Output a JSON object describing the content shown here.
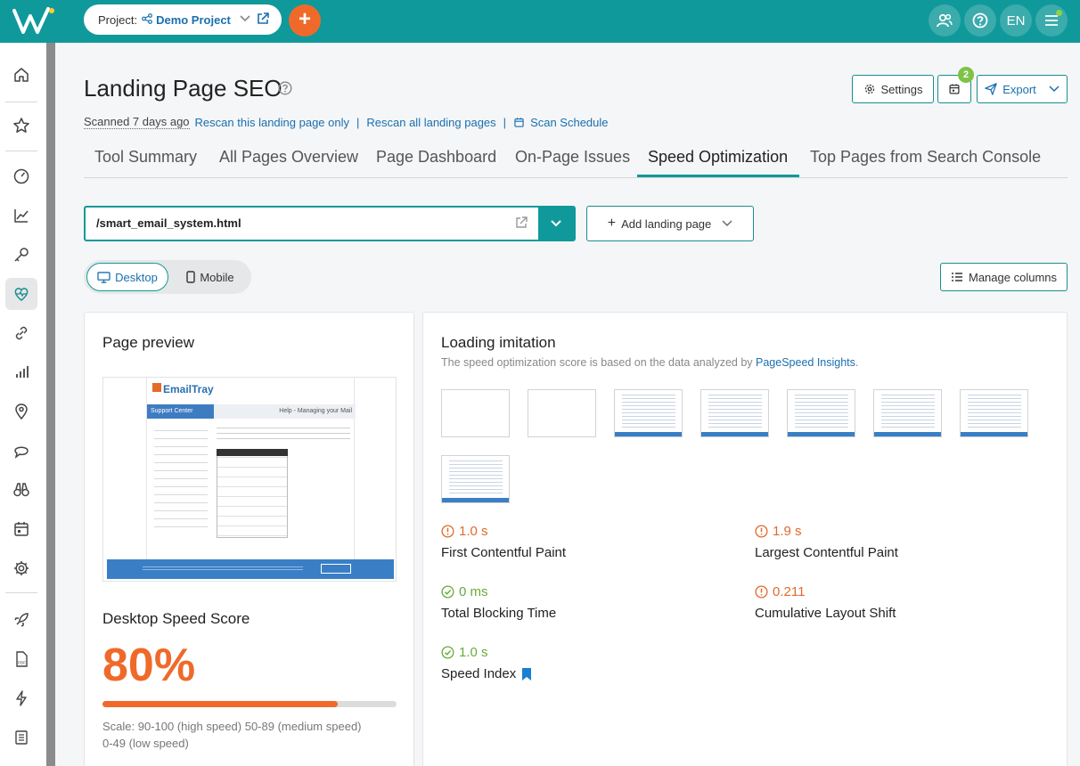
{
  "header": {
    "project_label": "Project:",
    "project_name": "Demo Project",
    "lang": "EN",
    "colors": {
      "bar": "#10999a",
      "accent": "#ef6a2a"
    }
  },
  "sidebar": {
    "items": [
      "home-icon",
      "star-icon",
      "gauge-icon",
      "chart-icon",
      "key-icon",
      "heart-pulse-icon",
      "link-icon",
      "bars-icon",
      "pin-icon",
      "chat-icon",
      "binoculars-icon",
      "calendar-icon",
      "gear-icon",
      "rocket-icon",
      "pdf-icon",
      "bolt-icon",
      "list-icon"
    ]
  },
  "page": {
    "title": "Landing Page SEO",
    "settings_label": "Settings",
    "calendar_badge": "2",
    "export_label": "Export",
    "scanned": "Scanned 7 days ago",
    "rescan_one": "Rescan this landing page only",
    "rescan_all": "Rescan all landing pages",
    "scan_schedule": "Scan Schedule"
  },
  "tabs": [
    "Tool Summary",
    "All Pages Overview",
    "Page Dashboard",
    "On-Page Issues",
    "Speed Optimization",
    "Top Pages from Search Console"
  ],
  "controls": {
    "url": "/smart_email_system.html",
    "add_landing_page": "Add landing page",
    "desktop": "Desktop",
    "mobile": "Mobile",
    "manage_columns": "Manage columns"
  },
  "preview_card": {
    "title": "Page preview",
    "score_title": "Desktop Speed Score",
    "score_text": "80%",
    "score_value": 80,
    "scale_line1": "Scale: 90-100 (high speed) 50-89 (medium speed)",
    "scale_line2": "0-49 (low speed)",
    "site_brand": "EmailTray",
    "site_section": "Support Center",
    "site_help": "Help - Managing your Mail"
  },
  "loading_card": {
    "title": "Loading imitation",
    "subtitle": "The speed optimization score is based on the data analyzed by",
    "subtitle_link": "PageSpeed Insights",
    "subtitle_end": ".",
    "metrics": [
      {
        "value": "1.0 s",
        "label": "First Contentful Paint",
        "status": "warn"
      },
      {
        "value": "1.9 s",
        "label": "Largest Contentful Paint",
        "status": "warn"
      },
      {
        "value": "0 ms",
        "label": "Total Blocking Time",
        "status": "good"
      },
      {
        "value": "0.211",
        "label": "Cumulative Layout Shift",
        "status": "warn"
      },
      {
        "value": "1.0 s",
        "label": "Speed Index",
        "status": "good"
      }
    ]
  }
}
